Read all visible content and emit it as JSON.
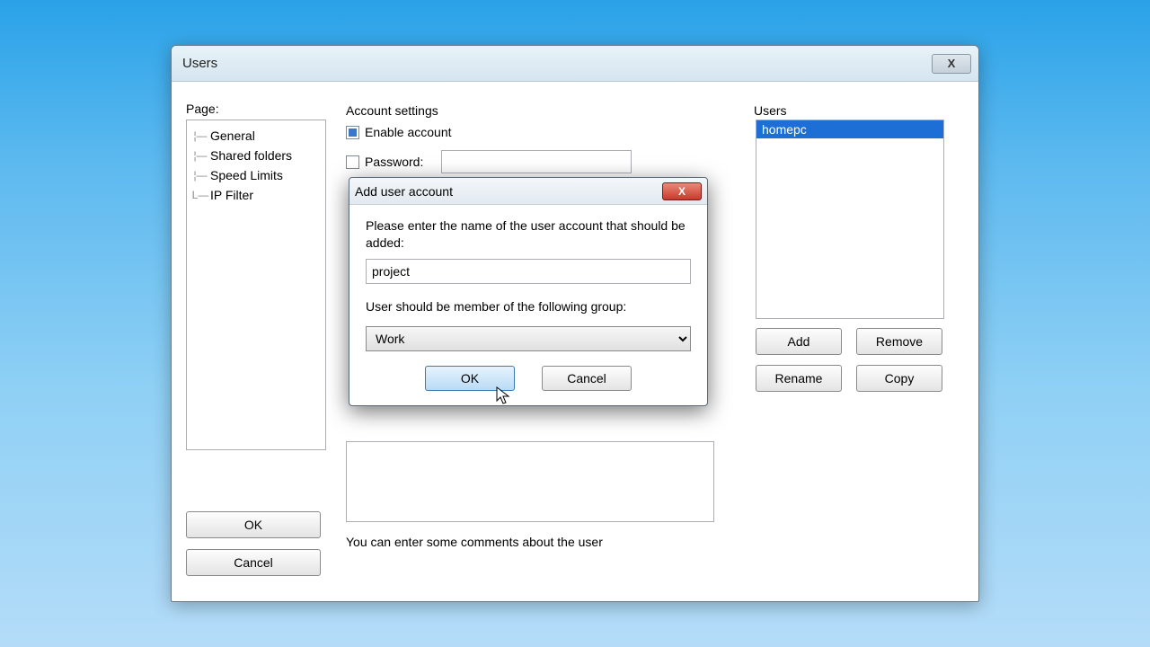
{
  "mainWindow": {
    "title": "Users",
    "close": "X"
  },
  "page": {
    "label": "Page:",
    "items": [
      "General",
      "Shared folders",
      "Speed Limits",
      "IP Filter"
    ]
  },
  "settings": {
    "label": "Account settings",
    "enableLabel": "Enable account",
    "enableChecked": true,
    "passwordLabel": "Password:",
    "passwordValue": ""
  },
  "usersPanel": {
    "label": "Users",
    "items": [
      "homepc"
    ],
    "selected": 0,
    "buttons": {
      "add": "Add",
      "remove": "Remove",
      "rename": "Rename",
      "copy": "Copy"
    }
  },
  "bottom": {
    "ok": "OK",
    "cancel": "Cancel",
    "commentHint": "You can enter some comments about the user"
  },
  "modal": {
    "title": "Add user account",
    "closeIcon": "X",
    "prompt": "Please enter the name of the user account that should be added:",
    "nameValue": "project",
    "groupLabel": "User should be member of the following group:",
    "groupValue": "Work",
    "ok": "OK",
    "cancel": "Cancel"
  }
}
